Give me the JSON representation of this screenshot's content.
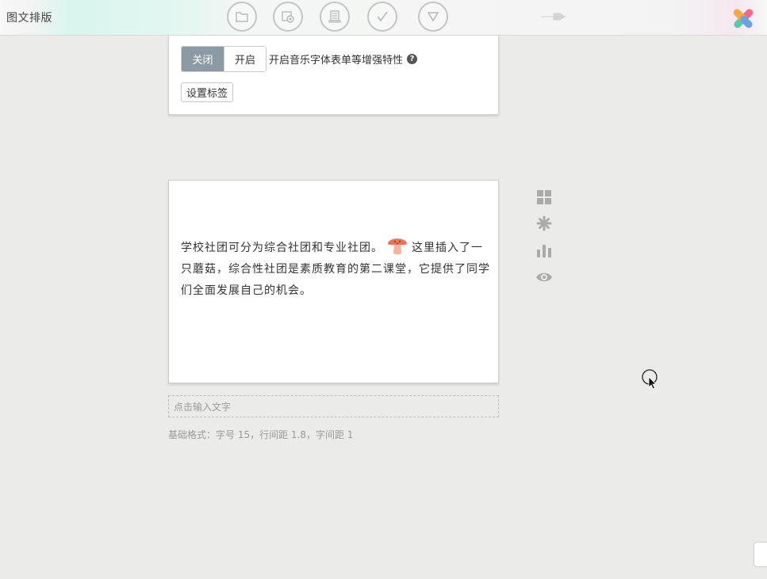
{
  "app": {
    "title": "图文排版"
  },
  "toolbar": {
    "icons": [
      "folder-icon",
      "images-icon",
      "document-icon",
      "check-icon",
      "dropdown-icon"
    ]
  },
  "settings": {
    "toggle_off": "关闭",
    "toggle_on": "开启",
    "feature_label": "开启音乐字体表单等增强特性",
    "help": "?",
    "set_tag_button": "设置标签"
  },
  "content": {
    "text_before": "学校社团可分为综合社团和专业社团。",
    "text_after": "这里插入了一只蘑菇，综合性社团是素质教育的第二课堂，它提供了同学们全面发展自己的机会。"
  },
  "input": {
    "placeholder": "点击输入文字"
  },
  "format_info": "基础格式：字号 15，行间距 1.8，字间距 1",
  "side_tools": [
    "grid-icon",
    "asterisk-icon",
    "bar-chart-icon",
    "eye-icon"
  ],
  "colors": {
    "toggle_active": "#8c9aa5",
    "background": "#ebebea",
    "mushroom": "#e8745a"
  }
}
